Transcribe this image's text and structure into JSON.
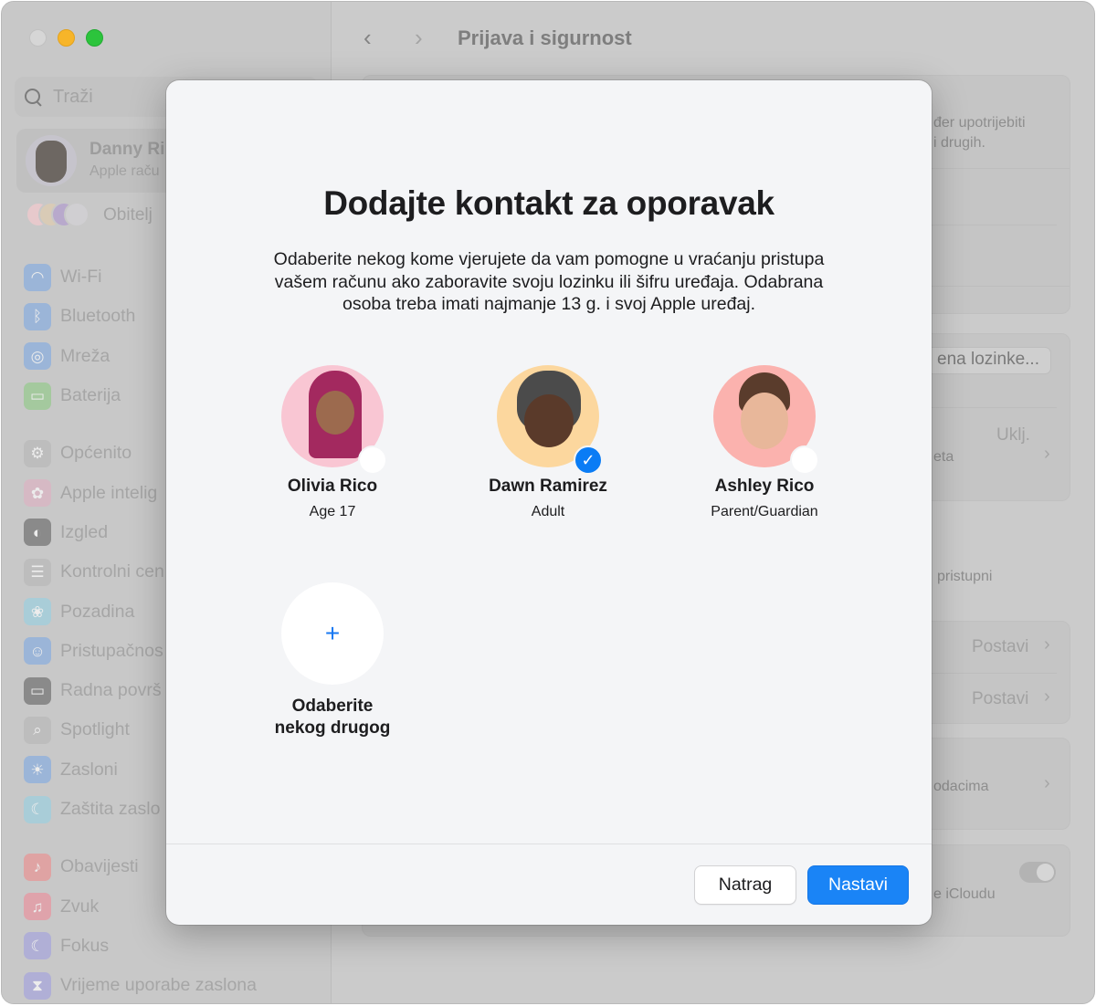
{
  "window": {
    "traffic_lights": [
      "close",
      "minimize",
      "maximize"
    ]
  },
  "sidebar": {
    "search_placeholder": "Traži",
    "profile": {
      "name": "Danny Ri",
      "subtitle": "Apple raču"
    },
    "family_label": "Obitelj",
    "items": [
      {
        "label": "Wi-Fi",
        "icon": "wifi-icon",
        "glyph": "◠",
        "color": "#9bb5d8"
      },
      {
        "label": "Bluetooth",
        "icon": "bluetooth-icon",
        "glyph": "ᛒ",
        "color": "#9bb5d8"
      },
      {
        "label": "Mreža",
        "icon": "globe-icon",
        "glyph": "◎",
        "color": "#9bb5d8"
      },
      {
        "label": "Baterija",
        "icon": "battery-icon",
        "glyph": "▭",
        "color": "#a4c99e"
      },
      {
        "label": "Općenito",
        "icon": "gear-icon",
        "glyph": "⚙",
        "color": "#bdbdbd"
      },
      {
        "label": "Apple intelig",
        "icon": "apple-intelligence-icon",
        "glyph": "✿",
        "color": "#d6b9c4"
      },
      {
        "label": "Izgled",
        "icon": "appearance-icon",
        "glyph": "◐",
        "color": "#8a8a8a"
      },
      {
        "label": "Kontrolni cen",
        "icon": "control-center-icon",
        "glyph": "☰",
        "color": "#bdbdbd"
      },
      {
        "label": "Pozadina",
        "icon": "wallpaper-icon",
        "glyph": "❀",
        "color": "#a9cdd8"
      },
      {
        "label": "Pristupačnos",
        "icon": "accessibility-icon",
        "glyph": "☺",
        "color": "#9bb5d8"
      },
      {
        "label": "Radna površ",
        "icon": "desktop-icon",
        "glyph": "▭",
        "color": "#8a8a8a"
      },
      {
        "label": "Spotlight",
        "icon": "spotlight-icon",
        "glyph": "⌕",
        "color": "#bdbdbd"
      },
      {
        "label": "Zasloni",
        "icon": "displays-icon",
        "glyph": "☀",
        "color": "#9bb5d8"
      },
      {
        "label": "Zaštita zaslo",
        "icon": "screensaver-icon",
        "glyph": "☾",
        "color": "#a9cdd8"
      },
      {
        "label": "Obavijesti",
        "icon": "notifications-icon",
        "glyph": "♪",
        "color": "#dfa3a3"
      },
      {
        "label": "Zvuk",
        "icon": "sound-icon",
        "glyph": "♫",
        "color": "#dfa3ab"
      },
      {
        "label": "Fokus",
        "icon": "focus-icon",
        "glyph": "☾",
        "color": "#b0afd6"
      },
      {
        "label": "Vrijeme uporabe zaslona",
        "icon": "screen-time-icon",
        "glyph": "⧗",
        "color": "#b0afd6"
      }
    ]
  },
  "main": {
    "title": "Prijava i sigurnost",
    "background_texts": {
      "card1_line1": "đer upotrijebiti",
      "card1_line2": "i drugih.",
      "password_button": "ena lozinke...",
      "status_on": "Uklj.",
      "status_sub": "eta",
      "access_text": "pristupni",
      "setup_1": "Postavi",
      "setup_2": "Postavi",
      "data_text": "odacima",
      "icloud_text": "e iCloudu"
    }
  },
  "dialog": {
    "title": "Dodajte kontakt za oporavak",
    "description": "Odaberite nekog kome vjerujete da vam pomogne u vraćanju pristupa vašem računu ako zaboravite svoju lozinku ili šifru uređaja. Odabrana osoba treba imati najmanje 13 g. i svoj Apple uređaj.",
    "contacts": [
      {
        "name": "Olivia Rico",
        "role": "Age 17",
        "selected": false,
        "bg": "#f9c6d3"
      },
      {
        "name": "Dawn Ramirez",
        "role": "Adult",
        "selected": true,
        "bg": "#fcd79e"
      },
      {
        "name": "Ashley Rico",
        "role": "Parent/Guardian",
        "selected": false,
        "bg": "#fbb2ae"
      }
    ],
    "add_other_label_line1": "Odaberite",
    "add_other_label_line2": "nekog drugog",
    "add_symbol": "+",
    "check_symbol": "✓",
    "back_button": "Natrag",
    "continue_button": "Nastavi",
    "accent_color": "#1a84f6"
  }
}
